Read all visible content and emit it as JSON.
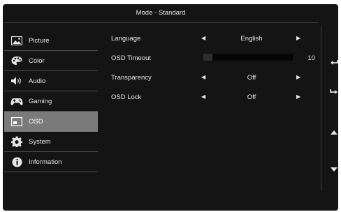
{
  "header": {
    "title": "Mode - Standard"
  },
  "sidebar": {
    "items": [
      {
        "label": "Picture",
        "icon": "picture-icon"
      },
      {
        "label": "Color",
        "icon": "color-palette-icon"
      },
      {
        "label": "Audio",
        "icon": "speaker-icon"
      },
      {
        "label": "Gaming",
        "icon": "gamepad-icon"
      },
      {
        "label": "OSD",
        "icon": "osd-icon",
        "active": true
      },
      {
        "label": "System",
        "icon": "gear-icon"
      },
      {
        "label": "Information",
        "icon": "info-icon"
      }
    ]
  },
  "settings": {
    "language": {
      "label": "Language",
      "value": "English"
    },
    "osd_timeout": {
      "label": "OSD Timeout",
      "value": "10",
      "level": 0.1
    },
    "transparency": {
      "label": "Transparency",
      "value": "Off"
    },
    "osd_lock": {
      "label": "OSD  Lock",
      "value": "Off"
    }
  },
  "right_controls": [
    "back-icon",
    "enter-icon",
    "up-arrow-icon",
    "down-arrow-icon"
  ]
}
